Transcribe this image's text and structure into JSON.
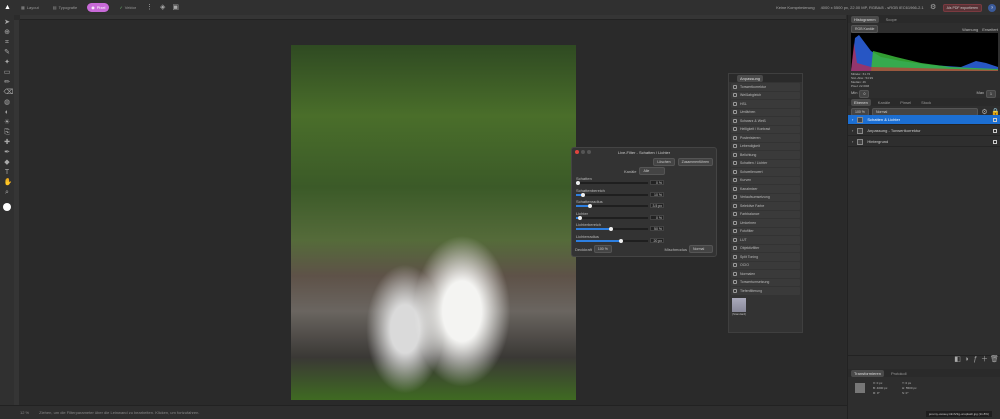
{
  "topbar": {
    "personas": [
      {
        "label": "Layout",
        "active": false
      },
      {
        "label": "Typografie",
        "active": false
      },
      {
        "label": "Pixel",
        "active": true
      },
      {
        "label": "Vektor",
        "active": false
      }
    ],
    "compression": "Keine Komprimierung",
    "docinfo": "4000 x 5500 px, 22.00 MP, RGBA/8 - sRGB IEC61966-2.1",
    "export_label": "Als PDF exportieren",
    "help": "?"
  },
  "dialog": {
    "title": "Live-Filter - Schatten / Lichter",
    "btn_delete": "Löschen",
    "btn_merge": "Zusammenführen",
    "channel_label": "Kanäle",
    "channel_value": "Alle",
    "sliders": [
      {
        "label": "Schatten",
        "value": "0 %",
        "fraction": 0.03
      },
      {
        "label": "Schattenbereich",
        "value": "10 %",
        "fraction": 0.1
      },
      {
        "label": "Schattenradius",
        "value": "3.5 px",
        "fraction": 0.2
      },
      {
        "label": "Lichter",
        "value": "0 %",
        "fraction": 0.05
      },
      {
        "label": "Lichterbereich",
        "value": "50 %",
        "fraction": 0.48
      },
      {
        "label": "Lichterradius",
        "value": "20 px",
        "fraction": 0.62
      }
    ],
    "opacity_label": "Deckkraft",
    "opacity_value": "100 %",
    "blend_label": "Mischmodus",
    "blend_value": "Normal"
  },
  "adjustments": {
    "title": "Anpassung",
    "items": [
      "Tonwertkorrektur",
      "Weißabgleich",
      "HSL",
      "Umfärben",
      "Schwarz & Weiß",
      "Helligkeit / Kontrast",
      "Posterisieren",
      "Lebendigkeit",
      "Belichtung",
      "Schatten / Lichter",
      "Schwellenwert",
      "Kurven",
      "Kanalmixer",
      "Verlaufsumsetzung",
      "Selektive Farbe",
      "Farbbalance",
      "Umkehren",
      "Fotofilter",
      "LUT",
      "Objektivfilter",
      "Split Toning",
      "OCIO",
      "Normalen",
      "Tonwertumsetzung",
      "Tiefenfilterung"
    ],
    "preset": "(Standard)"
  },
  "histogram": {
    "tabs": [
      "Histogramm",
      "Scope"
    ],
    "channel": "RGB Kanäle",
    "opt1": "Warnung",
    "opt2": "Erweitert",
    "stats": [
      "Mittelw.: 61.72",
      "Std.-Abw.: 54.99",
      "Median: 46",
      "Pixel: 22.00M"
    ],
    "min_label": "Min",
    "min_value": "0",
    "max_label": "Max",
    "max_value": "1"
  },
  "layers": {
    "tabs": [
      "Ebenen",
      "Kanäle",
      "Pinsel",
      "Stock"
    ],
    "opacity": "100 %",
    "blend": "Normal",
    "items": [
      {
        "name": "Schatten & Lichter",
        "selected": true
      },
      {
        "name": "Anpassung - Tonwertkorrektur",
        "selected": false
      },
      {
        "name": "Hintergrund",
        "selected": false
      }
    ]
  },
  "transform": {
    "tabs": [
      "Transformieren",
      "Protokoll"
    ],
    "fields": [
      "X: 0 px",
      "Y: 0 px",
      "B: 4000 px",
      "H: 5500 px",
      "R: 0°",
      "S: 0°"
    ]
  },
  "statusbar": {
    "zoom": "12 %",
    "hint": "Ziehen, um die Filterparameter über die Leinwand zu bearbeiten. Klicken, um fortzufahren.",
    "filename": "jeremy-vessey-tilmlV2g-unsplash.jpg (11.8%)"
  }
}
